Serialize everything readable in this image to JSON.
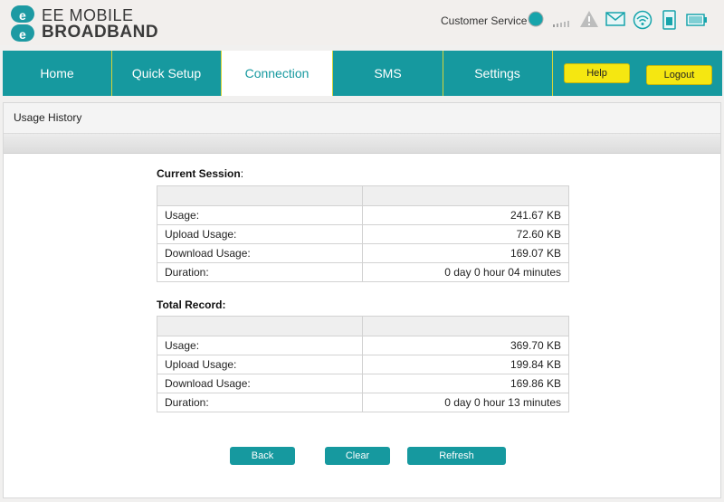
{
  "brand": {
    "line1": "EE MOBILE",
    "line2": "BROADBAND",
    "mark_letter": "e"
  },
  "header": {
    "customer_service": "Customer Service",
    "icons": [
      "status-dot-icon",
      "signal-icon",
      "warning-icon",
      "mail-icon",
      "wifi-icon",
      "sim-icon",
      "battery-icon"
    ]
  },
  "nav": {
    "tabs": [
      {
        "label": "Home"
      },
      {
        "label": "Quick Setup"
      },
      {
        "label": "Connection"
      },
      {
        "label": "SMS"
      },
      {
        "label": "Settings"
      }
    ],
    "active": "Connection",
    "help_label": "Help",
    "logout_label": "Logout"
  },
  "panel": {
    "title": "Usage History"
  },
  "current_session": {
    "heading": "Current Session",
    "heading_colon": ":",
    "rows": [
      {
        "label": "Usage:",
        "value": "241.67 KB"
      },
      {
        "label": "Upload Usage:",
        "value": "72.60 KB"
      },
      {
        "label": "Download Usage:",
        "value": "169.07 KB"
      },
      {
        "label": "Duration:",
        "value": "0 day 0 hour 04 minutes"
      }
    ]
  },
  "total_record": {
    "heading": "Total Record:",
    "rows": [
      {
        "label": "Usage:",
        "value": "369.70 KB"
      },
      {
        "label": "Upload Usage:",
        "value": "199.84 KB"
      },
      {
        "label": "Download Usage:",
        "value": "169.86 KB"
      },
      {
        "label": "Duration:",
        "value": "0 day 0 hour 13 minutes"
      }
    ]
  },
  "buttons": {
    "back": "Back",
    "clear": "Clear",
    "refresh": "Refresh"
  },
  "colors": {
    "teal": "#16999f",
    "yellow": "#f5e711",
    "divider": "#d4d43a"
  }
}
